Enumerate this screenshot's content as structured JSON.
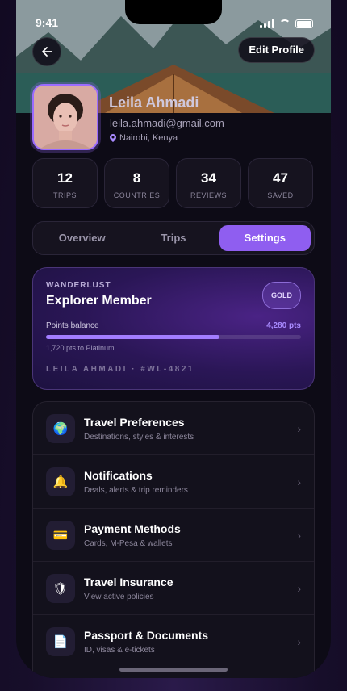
{
  "status": {
    "time": "9:41"
  },
  "header": {
    "edit_label": "Edit Profile"
  },
  "profile": {
    "name": "Leila Ahmadi",
    "email": "leila.ahmadi@gmail.com",
    "location": "Nairobi, Kenya"
  },
  "stats": [
    {
      "value": "12",
      "label": "TRIPS"
    },
    {
      "value": "8",
      "label": "COUNTRIES"
    },
    {
      "value": "34",
      "label": "REVIEWS"
    },
    {
      "value": "47",
      "label": "SAVED"
    }
  ],
  "tabs": [
    {
      "label": "Overview"
    },
    {
      "label": "Trips"
    },
    {
      "label": "Settings"
    }
  ],
  "membership": {
    "kicker": "WANDERLUST",
    "title": "Explorer Member",
    "tier": "GOLD",
    "points_label": "Points balance",
    "points_value": "4,280 pts",
    "progress": 0.68,
    "next_tier": "1,720 pts to Platinum",
    "footer": "LEILA AHMADI · #WL-4821"
  },
  "settings": [
    {
      "title": "Travel Preferences",
      "subtitle": "Destinations, styles & interests",
      "icon": "globe-icon",
      "glyph": "🌍"
    },
    {
      "title": "Notifications",
      "subtitle": "Deals, alerts & trip reminders",
      "icon": "bell-icon",
      "glyph": "🔔"
    },
    {
      "title": "Payment Methods",
      "subtitle": "Cards, M-Pesa & wallets",
      "icon": "card-icon",
      "glyph": "💳"
    },
    {
      "title": "Travel Insurance",
      "subtitle": "View active policies",
      "icon": "shield-icon",
      "glyph": "🛡"
    },
    {
      "title": "Passport & Documents",
      "subtitle": "ID, visas & e-tickets",
      "icon": "document-icon",
      "glyph": "📄"
    }
  ],
  "colors": {
    "accent": "#8f5ef0",
    "background": "#0d0b16",
    "card": "#16131f"
  }
}
